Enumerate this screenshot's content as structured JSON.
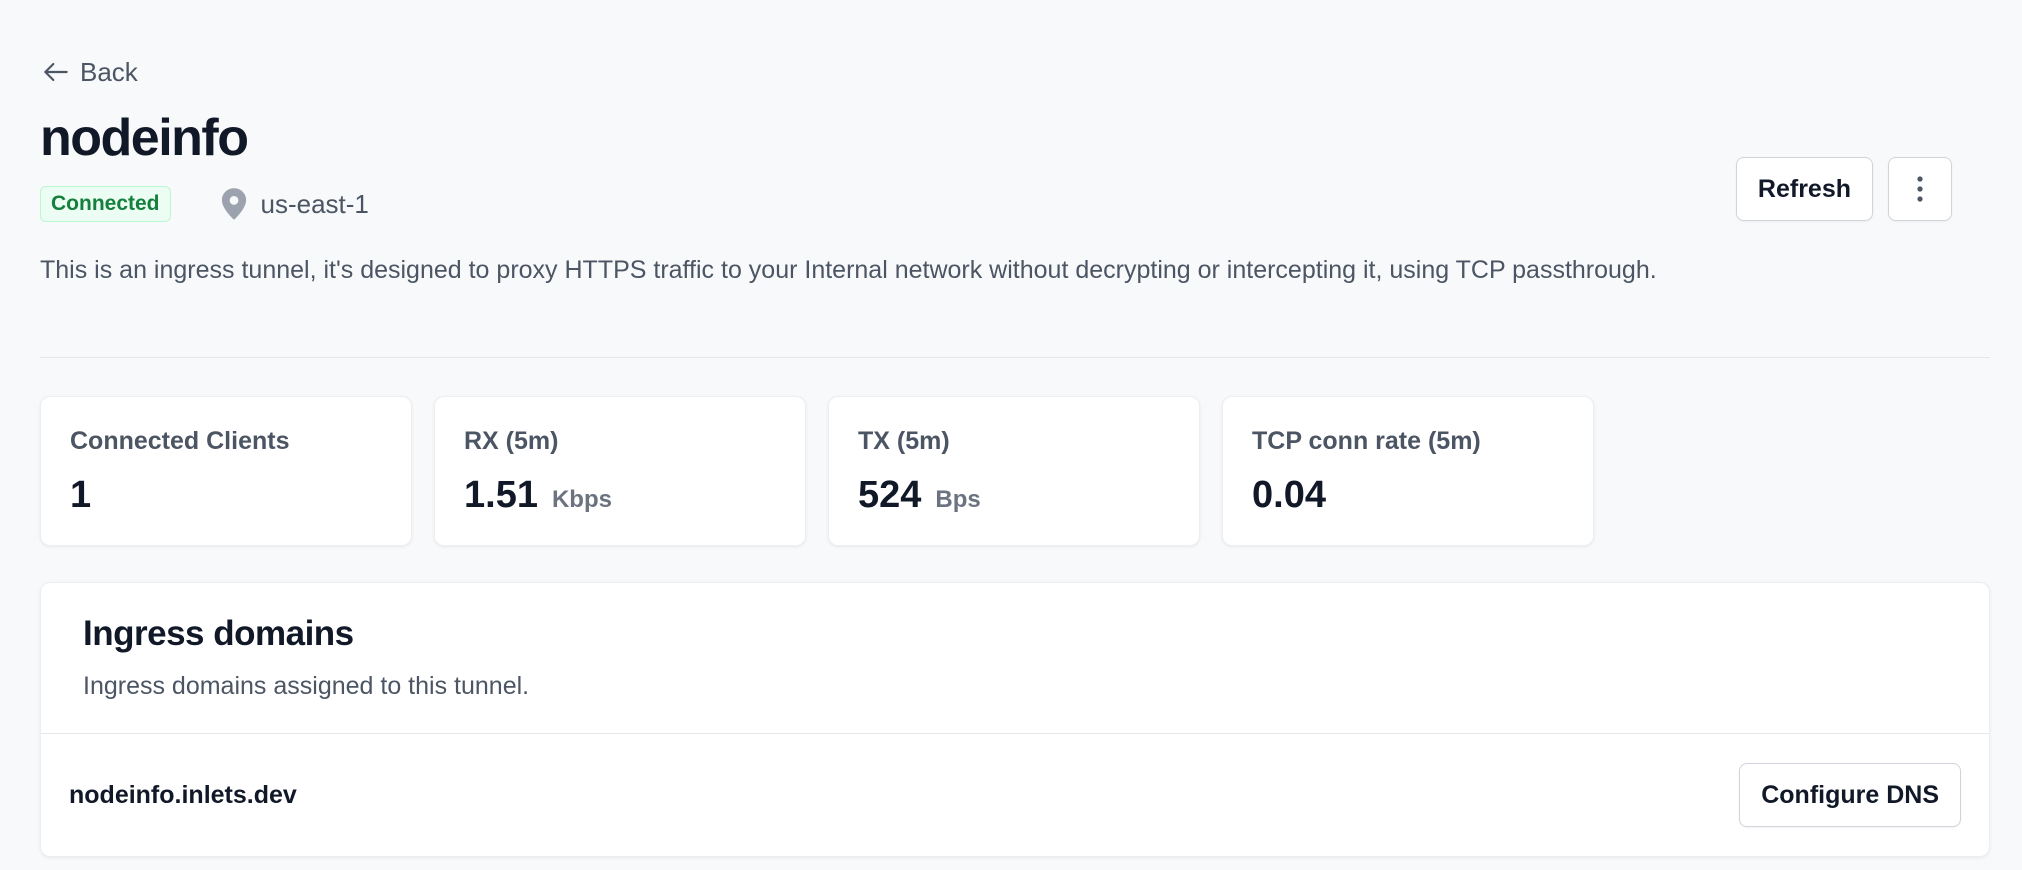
{
  "nav": {
    "back_label": "Back"
  },
  "tunnel": {
    "name": "nodeinfo",
    "status": "Connected",
    "region": "us-east-1",
    "description": "This is an ingress tunnel, it's designed to proxy HTTPS traffic to your Internal network without decrypting or intercepting it, using TCP passthrough."
  },
  "actions": {
    "refresh_label": "Refresh",
    "more_icon": "vertical-ellipsis-icon"
  },
  "stats": [
    {
      "label": "Connected Clients",
      "value": "1",
      "unit": ""
    },
    {
      "label": "RX (5m)",
      "value": "1.51",
      "unit": "Kbps"
    },
    {
      "label": "TX (5m)",
      "value": "524",
      "unit": "Bps"
    },
    {
      "label": "TCP conn rate (5m)",
      "value": "0.04",
      "unit": ""
    }
  ],
  "domains": {
    "title": "Ingress domains",
    "subtitle": "Ingress domains assigned to this tunnel.",
    "items": [
      {
        "name": "nodeinfo.inlets.dev",
        "action_label": "Configure DNS"
      }
    ]
  },
  "colors": {
    "background": "#f8f9fb",
    "status_green": "#15803d",
    "status_bg": "#ecfdf3",
    "text_primary": "#111827",
    "text_secondary": "#4b5563"
  }
}
